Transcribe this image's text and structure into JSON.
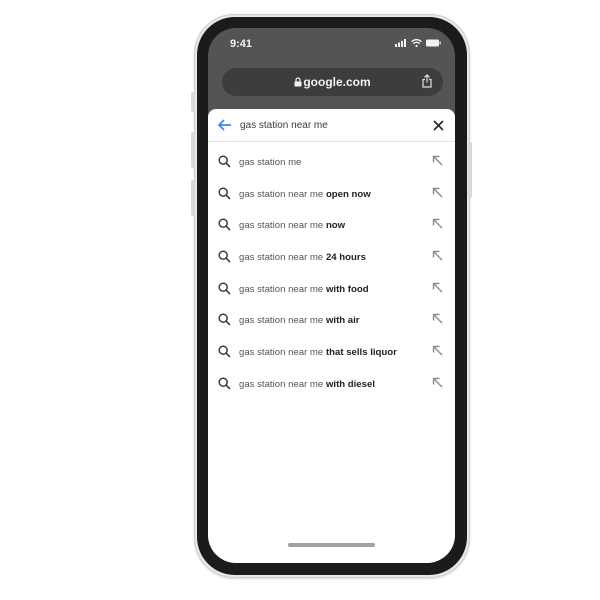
{
  "status_bar": {
    "time": "9:41"
  },
  "browser": {
    "url": "google.com",
    "lock_icon": "lock-icon",
    "share_icon": "share-icon"
  },
  "search": {
    "query": "gas station near me",
    "back_icon": "back-arrow-icon",
    "clear_icon": "close-icon"
  },
  "suggestions": [
    {
      "prefix": "gas station me",
      "suffix": ""
    },
    {
      "prefix": "gas station near me ",
      "suffix": "open now"
    },
    {
      "prefix": "gas station near me ",
      "suffix": "now"
    },
    {
      "prefix": "gas station near me ",
      "suffix": "24 hours"
    },
    {
      "prefix": "gas station near me ",
      "suffix": "with food"
    },
    {
      "prefix": "gas station near me ",
      "suffix": "with air"
    },
    {
      "prefix": "gas station near me ",
      "suffix": "that sells liquor"
    },
    {
      "prefix": "gas station near me ",
      "suffix": "with diesel"
    }
  ],
  "colors": {
    "accent": "#4285f4",
    "screen_bg": "#545454",
    "urlbar_bg": "#3d3d3d"
  }
}
